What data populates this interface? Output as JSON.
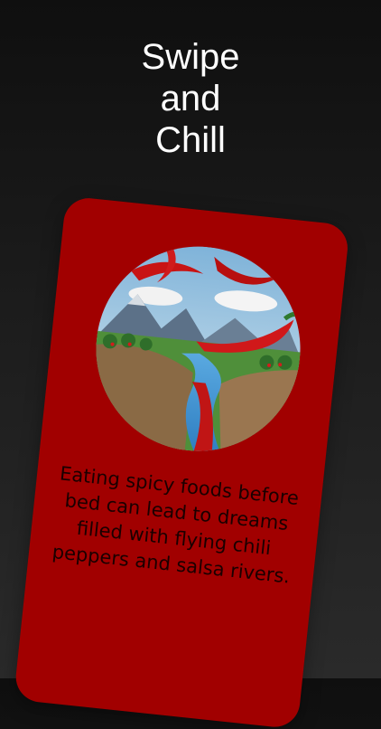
{
  "header": {
    "title_line1": "Swipe",
    "title_line2": "and",
    "title_line3": "Chill"
  },
  "card": {
    "background_color": "#a10000",
    "image_icon": "chili-river-illustration",
    "text": "Eating spicy foods before bed can lead to dreams filled with flying chili peppers and salsa rivers."
  }
}
